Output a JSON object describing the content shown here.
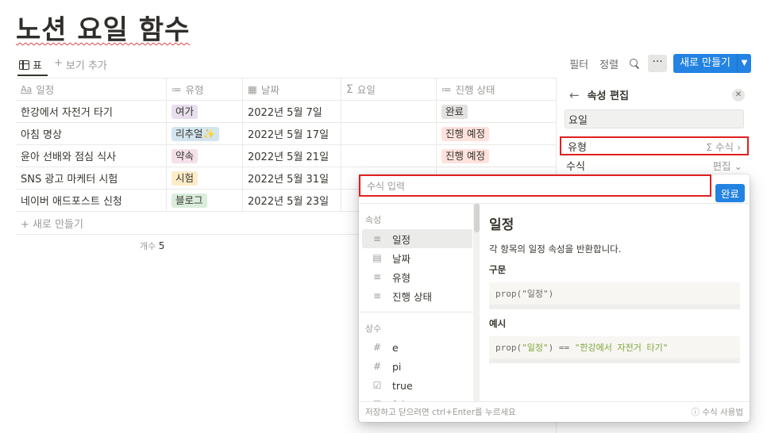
{
  "page": {
    "title": "노션 요일 함수"
  },
  "toolbar": {
    "view_label": "표",
    "add_view": "보기 추가",
    "filter": "필터",
    "sort": "정렬",
    "more": "···",
    "new": "새로 만들기"
  },
  "table": {
    "headers": [
      {
        "icon": "Aa",
        "label": "일정"
      },
      {
        "icon": "≔",
        "label": "유형"
      },
      {
        "icon": "▦",
        "label": "날짜"
      },
      {
        "icon": "Σ",
        "label": "요일"
      },
      {
        "icon": "≔",
        "label": "진행 상태"
      }
    ],
    "rows": [
      {
        "name": "한강에서 자전거 타기",
        "type": "여가",
        "type_color": "#e8deee",
        "date": "2022년 5월 7일",
        "status": "완료",
        "status_color": "#e3e2e0"
      },
      {
        "name": "아침 명상",
        "type": "리추얼✨",
        "type_color": "#d3e5ef",
        "date": "2022년 5월 17일",
        "status": "진행 예정",
        "status_color": "#ffe2dd"
      },
      {
        "name": "윤아 선배와 점심 식사",
        "type": "약속",
        "type_color": "#f5e0e9",
        "date": "2022년 5월 21일",
        "status": "진행 예정",
        "status_color": "#ffe2dd"
      },
      {
        "name": "SNS 광고 마케터 시험",
        "type": "시험",
        "type_color": "#fdecc8",
        "date": "2022년 5월 31일",
        "status": "",
        "status_color": "#ffe2dd"
      },
      {
        "name": "네이버 애드포스트 신청",
        "type": "블로그",
        "type_color": "#dbeddb",
        "date": "2022년 5월 23일",
        "status": "",
        "status_color": "#ffe2dd"
      }
    ],
    "new_row": "새로 만들기",
    "count_label": "개수",
    "count_value": "5"
  },
  "side_panel": {
    "title": "속성 편집",
    "name_value": "요일",
    "type_label": "유형",
    "type_value": "Σ 수식",
    "formula_label": "수식",
    "formula_value": "편집"
  },
  "formula_popup": {
    "placeholder": "수식 입력",
    "done": "완료",
    "sections": [
      {
        "label": "속성",
        "items": [
          {
            "icon": "text-icon",
            "glyph": "≡",
            "label": "일정"
          },
          {
            "icon": "calendar-icon",
            "glyph": "▤",
            "label": "날짜"
          },
          {
            "icon": "text-icon",
            "glyph": "≡",
            "label": "유형"
          },
          {
            "icon": "text-icon",
            "glyph": "≡",
            "label": "진행 상태"
          }
        ]
      },
      {
        "label": "상수",
        "items": [
          {
            "icon": "hash-icon",
            "glyph": "#",
            "label": "e"
          },
          {
            "icon": "hash-icon",
            "glyph": "#",
            "label": "pi"
          },
          {
            "icon": "checkbox-icon",
            "glyph": "☑",
            "label": "true"
          },
          {
            "icon": "checkbox-icon",
            "glyph": "☑",
            "label": "false"
          }
        ]
      }
    ],
    "doc": {
      "title": "일정",
      "desc": "각 항목의 일정 속성을 반환합니다.",
      "syntax_label": "구문",
      "syntax_fn": "prop(",
      "syntax_arg": "\"일정\"",
      "syntax_end": ")",
      "example_label": "예시",
      "example_fn": "prop(",
      "example_arg": "\"일정\"",
      "example_mid": ") == ",
      "example_str": "\"한강에서 자전거 타기\""
    },
    "footer_hint": "저장하고 닫으려면 ctrl+Enter를 누르세요",
    "footer_help": "ⓘ 수식 사용법"
  }
}
